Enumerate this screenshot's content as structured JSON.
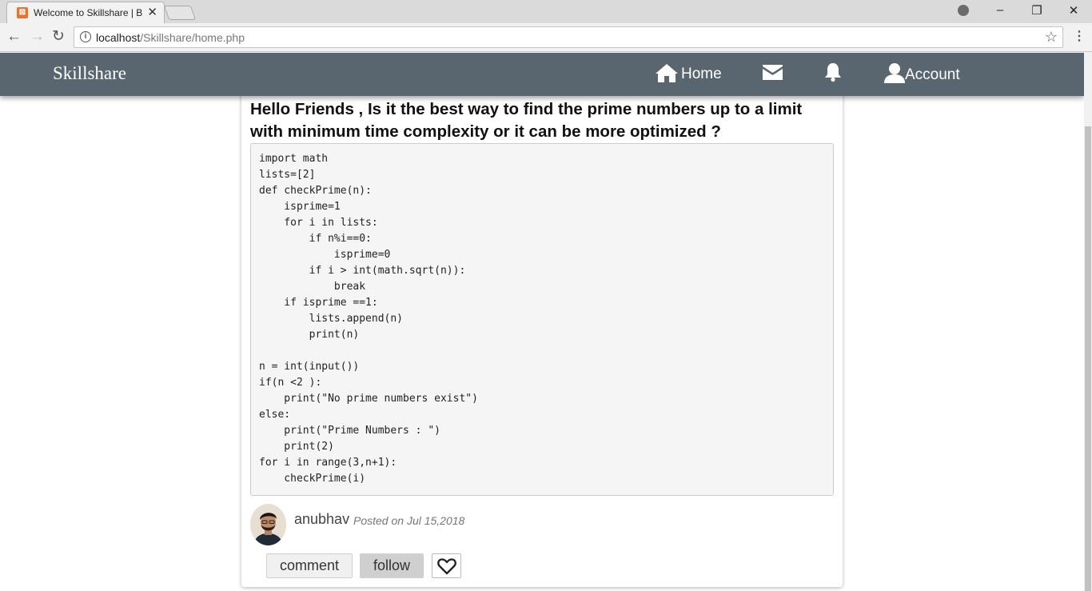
{
  "browser": {
    "tab_title": "Welcome to Skillshare | B",
    "url_host": "localhost",
    "url_path": "/Skillshare/home.php"
  },
  "nav": {
    "brand": "Skillshare",
    "home_label": "Home",
    "account_label": "Account"
  },
  "post": {
    "title": "Hello Friends , Is it the best way to find the prime numbers up to a limit with minimum time complexity or it can be more optimized ?",
    "code": "import math\nlists=[2]\ndef checkPrime(n):\n    isprime=1\n    for i in lists:\n        if n%i==0:\n            isprime=0\n        if i > int(math.sqrt(n)):\n            break\n    if isprime ==1:\n        lists.append(n)\n        print(n)\n\nn = int(input())\nif(n <2 ):\n    print(\"No prime numbers exist\")\nelse:\n    print(\"Prime Numbers : \")\n    print(2)\nfor i in range(3,n+1):\n    checkPrime(i)",
    "author": "anubhav",
    "posted": "Posted on Jul 15,2018"
  },
  "actions": {
    "comment_label": "comment",
    "follow_label": "follow"
  }
}
